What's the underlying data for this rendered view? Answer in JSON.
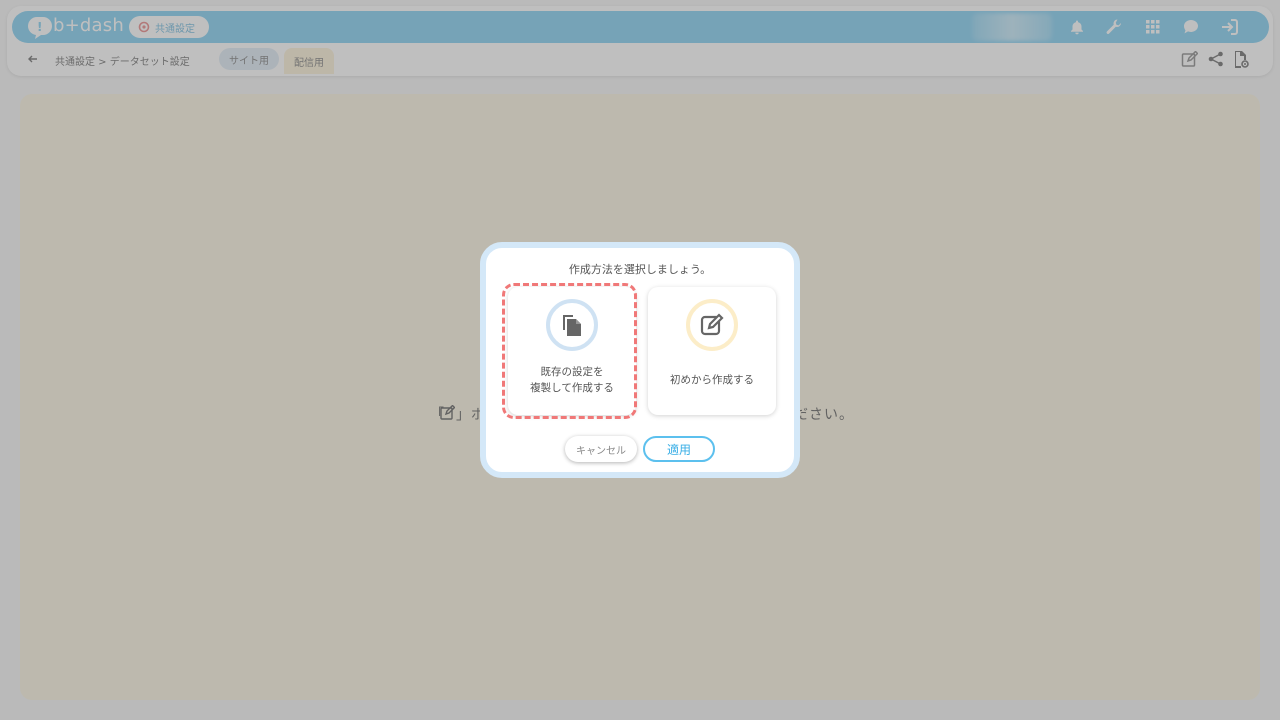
{
  "header": {
    "logo_text": "b+dash",
    "section_label": "共通設定",
    "icons": [
      "bell-icon",
      "wrench-icon",
      "grid-icon",
      "support-icon",
      "logout-icon"
    ]
  },
  "breadcrumb": {
    "text": "共通設定 > データセット設定"
  },
  "tabs": [
    {
      "label": "サイト用"
    },
    {
      "label": "配信用"
    }
  ],
  "toolbar": {
    "icons": [
      "edit-icon",
      "share-icon",
      "settings-file-icon"
    ]
  },
  "main": {
    "hint_left": "「",
    "hint_right": "」ボ",
    "hint_end": "ださい。"
  },
  "modal": {
    "title": "作成方法を選択しましょう。",
    "options": [
      {
        "label": "既存の設定を\n複製して作成する",
        "icon": "copy-icon"
      },
      {
        "label": "初めから作成する",
        "icon": "edit-icon"
      }
    ],
    "cancel_label": "キャンセル",
    "apply_label": "適用"
  },
  "colors": {
    "header_blue": "#6cc6ef",
    "panel_background": "#fbf3dc",
    "highlight": "#f07878",
    "apply_blue": "#38aee6"
  }
}
